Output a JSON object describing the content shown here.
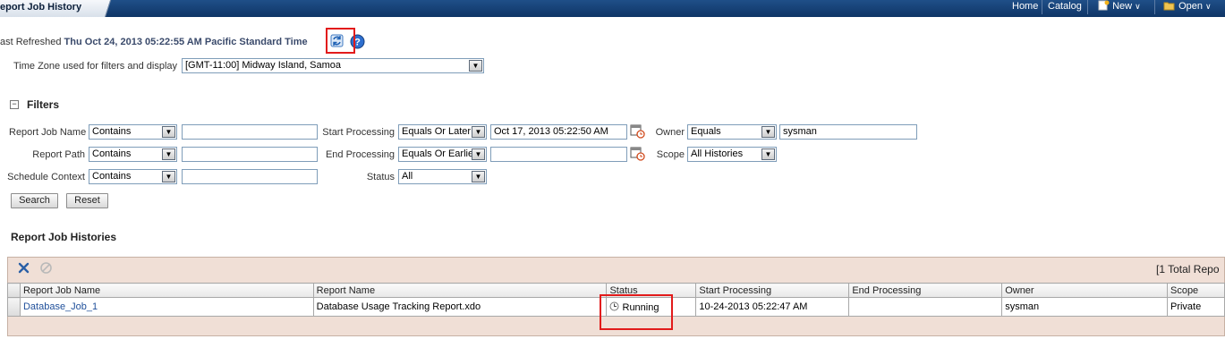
{
  "header": {
    "page_title": "eport Job History",
    "nav": {
      "home": "Home",
      "catalog": "Catalog",
      "new": "New",
      "open": "Open"
    }
  },
  "refresh": {
    "prefix": "ast Refreshed",
    "timestamp": "Thu Oct 24, 2013 05:22:55 AM Pacific Standard Time"
  },
  "timezone": {
    "label": "Time Zone used for filters and display",
    "value": "[GMT-11:00] Midway Island, Samoa"
  },
  "filters": {
    "title": "Filters",
    "report_job_name": {
      "label": "Report Job Name",
      "operator": "Contains",
      "value": ""
    },
    "report_path": {
      "label": "Report Path",
      "operator": "Contains",
      "value": ""
    },
    "schedule_context": {
      "label": "Schedule Context",
      "operator": "Contains",
      "value": ""
    },
    "start_processing": {
      "label": "Start Processing",
      "operator": "Equals Or Later",
      "value": "Oct 17, 2013 05:22:50 AM"
    },
    "end_processing": {
      "label": "End Processing",
      "operator": "Equals Or Earlie",
      "value": ""
    },
    "status": {
      "label": "Status",
      "value": "All"
    },
    "owner": {
      "label": "Owner",
      "operator": "Equals",
      "value": "sysman"
    },
    "scope": {
      "label": "Scope",
      "value": "All Histories"
    },
    "search_label": "Search",
    "reset_label": "Reset"
  },
  "histories": {
    "title": "Report Job Histories",
    "total": "[1 Total Repo",
    "columns": [
      "Report Job Name",
      "Report Name",
      "Status",
      "Start Processing",
      "End Processing",
      "Owner",
      "Scope"
    ],
    "rows": [
      {
        "job_name": "Database_Job_1",
        "report_name": "Database Usage Tracking Report.xdo",
        "status": "Running",
        "start": "10-24-2013 05:22:47 AM",
        "end": "",
        "owner": "sysman",
        "scope": "Private"
      }
    ]
  },
  "colors": {
    "topbar": "#0f3566",
    "link": "#1f4f9a",
    "panel": "#f0dfd6",
    "callout": "#e21b1b"
  },
  "icons": [
    "refresh-icon",
    "help-icon",
    "calendar-icon",
    "delete-icon",
    "cancel-icon",
    "clock-icon",
    "collapse-icon",
    "chevron-down-icon"
  ]
}
